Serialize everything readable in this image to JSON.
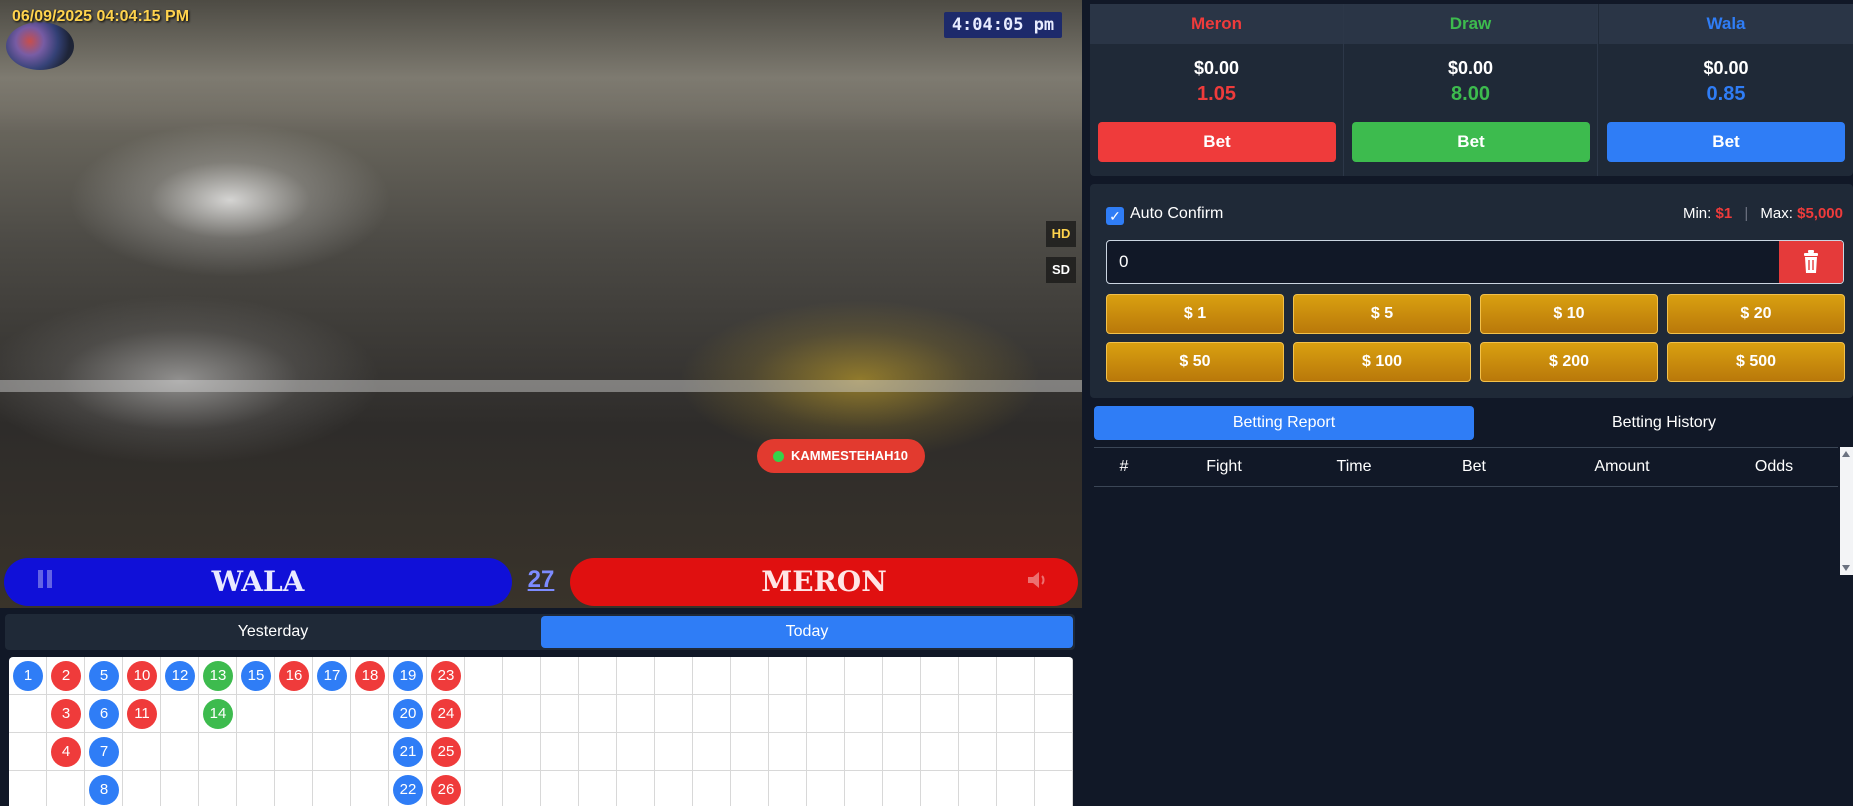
{
  "stream": {
    "timestamp": "06/09/2025 04:04:15 PM",
    "clock": "4:04:05 pm",
    "quality": {
      "hd": "HD",
      "sd": "SD"
    },
    "player_tag": "KAMMESTEHAH10",
    "banner": {
      "wala": "WALA",
      "fight_number": "27",
      "meron": "MERON"
    }
  },
  "days": {
    "yesterday": "Yesterday",
    "today": "Today",
    "active": "today"
  },
  "results_grid": {
    "columns": [
      [
        {
          "n": "1",
          "c": "blue"
        }
      ],
      [
        {
          "n": "2",
          "c": "red"
        },
        {
          "n": "3",
          "c": "red"
        },
        {
          "n": "4",
          "c": "red"
        }
      ],
      [
        {
          "n": "5",
          "c": "blue"
        },
        {
          "n": "6",
          "c": "blue"
        },
        {
          "n": "7",
          "c": "blue"
        },
        {
          "n": "8",
          "c": "blue"
        }
      ],
      [
        {
          "n": "10",
          "c": "red"
        },
        {
          "n": "11",
          "c": "red"
        }
      ],
      [
        {
          "n": "12",
          "c": "blue"
        }
      ],
      [
        {
          "n": "13",
          "c": "green"
        },
        {
          "n": "14",
          "c": "green"
        }
      ],
      [
        {
          "n": "15",
          "c": "blue"
        }
      ],
      [
        {
          "n": "16",
          "c": "red"
        }
      ],
      [
        {
          "n": "17",
          "c": "blue"
        }
      ],
      [
        {
          "n": "18",
          "c": "red"
        }
      ],
      [
        {
          "n": "19",
          "c": "blue"
        },
        {
          "n": "20",
          "c": "blue"
        },
        {
          "n": "21",
          "c": "blue"
        },
        {
          "n": "22",
          "c": "blue"
        }
      ],
      [
        {
          "n": "23",
          "c": "red"
        },
        {
          "n": "24",
          "c": "red"
        },
        {
          "n": "25",
          "c": "red"
        },
        {
          "n": "26",
          "c": "red"
        }
      ]
    ],
    "total_columns": 28,
    "colors": {
      "blue": "#2f7df6",
      "red": "#ef3b3b",
      "green": "#3dbb4e"
    }
  },
  "bets": [
    {
      "name": "Meron",
      "amount": "$0.00",
      "odds": "1.05",
      "button": "Bet",
      "color": "#ef3b3b"
    },
    {
      "name": "Draw",
      "amount": "$0.00",
      "odds": "8.00",
      "button": "Bet",
      "color": "#3dbb4e"
    },
    {
      "name": "Wala",
      "amount": "$0.00",
      "odds": "0.85",
      "button": "Bet",
      "color": "#2f7df6"
    }
  ],
  "stake": {
    "auto_confirm_label": "Auto Confirm",
    "auto_confirm_checked": true,
    "min_label": "Min:",
    "min_value": "$1",
    "max_label": "Max:",
    "max_value": "$5,000",
    "amount_value": "0",
    "chips": [
      "$ 1",
      "$ 5",
      "$ 10",
      "$ 20",
      "$ 50",
      "$ 100",
      "$ 200",
      "$ 500"
    ]
  },
  "report": {
    "tabs": {
      "report": "Betting Report",
      "history": "Betting History",
      "active": "report"
    },
    "columns": [
      "#",
      "Fight",
      "Time",
      "Bet",
      "Amount",
      "Odds"
    ]
  }
}
